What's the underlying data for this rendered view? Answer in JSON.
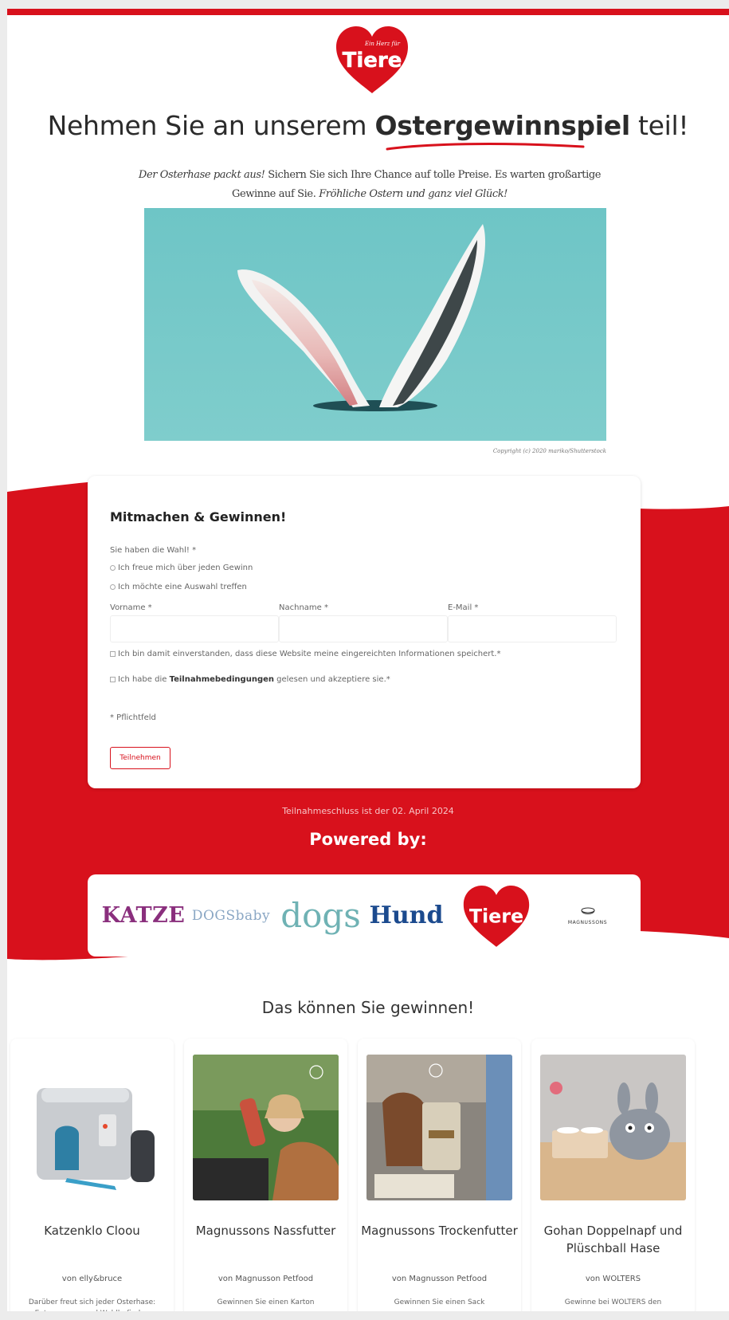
{
  "brand": {
    "logo_small_text": "Ein Herz für",
    "logo_text": "Tiere",
    "color_red": "#d8111c"
  },
  "headline": {
    "prefix": "Nehmen Sie an unserem ",
    "highlight": "Ostergewinnspiel",
    "suffix": " teil!"
  },
  "intro": {
    "italic1": "Der Osterhase packt aus!",
    "text1": " Sichern Sie sich Ihre Chance auf tolle Preise. Es warten großartige Gewinne auf Sie. ",
    "italic2": "Fröhliche Ostern und ganz viel Glück!"
  },
  "hero": {
    "copyright": "Copyright (c) 2020 mariko/Shutterstock"
  },
  "form": {
    "title": "Mitmachen & Gewinnen!",
    "choice_label": "Sie haben die Wahl! *",
    "choice_options": [
      "Ich freue mich über jeden Gewinn",
      "Ich möchte eine Auswahl treffen"
    ],
    "fields": [
      {
        "label": "Vorname *",
        "value": ""
      },
      {
        "label": "Nachname *",
        "value": ""
      },
      {
        "label": "E-Mail *",
        "value": ""
      }
    ],
    "consent_storage": "Ich bin damit einverstanden, dass diese Website meine eingereichten Informationen speichert.*",
    "consent_terms_pre": "Ich habe die ",
    "consent_terms_link": "Teilnahmebedingungen",
    "consent_terms_post": " gelesen und akzeptiere sie.*",
    "required_note": "* Pflichtfeld",
    "submit_label": "Teilnehmen"
  },
  "deadline": "Teilnahmeschluss ist der 02. April 2024",
  "powered_by": {
    "title": "Powered by:",
    "brands": [
      "KATZE",
      "DOGSbaby",
      "dogs",
      "Hund",
      "Tiere",
      "MAGNUSSONS"
    ]
  },
  "prizes_title": "Das können Sie gewinnen!",
  "prizes": [
    {
      "name": "Katzenklo Cloou",
      "by": "von elly&bruce",
      "desc": "Darüber freut sich jeder Osterhase: Entspannung und Wohlbefinden"
    },
    {
      "name": "Magnussons Nassfutter",
      "by": "von Magnusson Petfood",
      "desc": "Gewinnen Sie einen Karton"
    },
    {
      "name": "Magnussons Trockenfutter",
      "by": "von Magnusson Petfood",
      "desc": "Gewinnen Sie einen Sack"
    },
    {
      "name": "Gohan Doppelnapf und Plüschball Hase",
      "by": "von WOLTERS",
      "desc": "Gewinne bei WOLTERS den"
    }
  ]
}
